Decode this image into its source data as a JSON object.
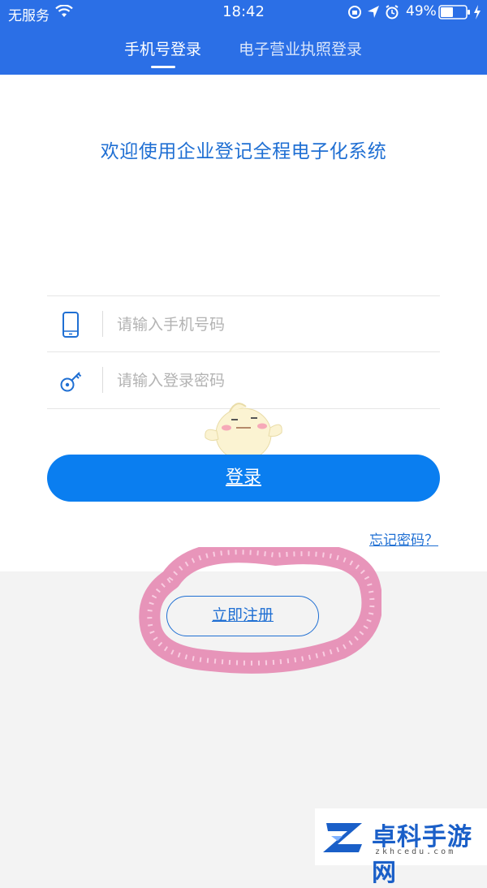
{
  "status_bar": {
    "carrier": "无服务",
    "time": "18:42",
    "battery_percent": "49%",
    "icons": [
      "wifi-icon",
      "rotation-lock-icon",
      "location-icon",
      "alarm-icon",
      "battery-icon",
      "charging-icon"
    ]
  },
  "tabs": [
    {
      "label": "手机号登录",
      "active": true
    },
    {
      "label": "电子营业执照登录",
      "active": false
    }
  ],
  "welcome_title": "欢迎使用企业登记全程电子化系统",
  "form": {
    "phone": {
      "placeholder": "请输入手机号码",
      "value": "",
      "icon": "phone-icon"
    },
    "password": {
      "placeholder": "请输入登录密码",
      "value": "",
      "icon": "key-icon"
    },
    "login_label": "登录",
    "forgot_label": "忘记密码？"
  },
  "register_label": "立即注册",
  "watermark": {
    "name": "卓科手游网",
    "url": "zkhcedu.com"
  },
  "colors": {
    "header": "#2b6fe6",
    "primary_button": "#0a7ef0",
    "link": "#1f6fd3",
    "background": "#f3f3f3"
  }
}
